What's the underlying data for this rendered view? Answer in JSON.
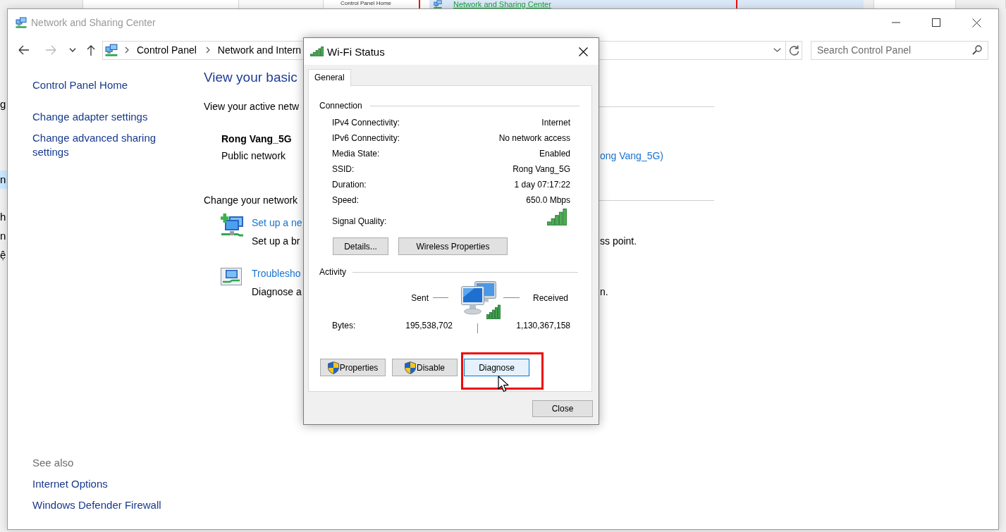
{
  "background_window": {
    "sidebar_link": "Control Panel Home",
    "nav_item": {
      "label": "Network and Sharing Center",
      "selected": true
    },
    "edge_items": [
      {
        "text": "g",
        "selected": false
      },
      {
        "text": "n",
        "selected": true
      },
      {
        "text": "h",
        "selected": false
      },
      {
        "text": "n",
        "selected": false
      },
      {
        "text": "ệ",
        "selected": false
      }
    ]
  },
  "window": {
    "title": "Network and Sharing Center",
    "active": false
  },
  "nav_buttons": [
    {
      "kind": "back",
      "disabled": false
    },
    {
      "kind": "forward",
      "disabled": true
    },
    {
      "kind": "recent",
      "disabled": false
    },
    {
      "kind": "up",
      "disabled": false
    }
  ],
  "address_bar": {
    "breadcrumbs": [
      "Control Panel",
      "Network and Intern"
    ]
  },
  "search": {
    "placeholder": "Search Control Panel"
  },
  "sidebar": {
    "home": "Control Panel Home",
    "items": [
      "Change adapter settings",
      "Change advanced sharing settings"
    ],
    "see_also": {
      "title": "See also",
      "items": [
        "Internet Options",
        "Windows Defender Firewall"
      ]
    }
  },
  "content": {
    "heading": "View your basic",
    "active_networks": {
      "title": "View your active netw",
      "name": "Rong Vang_5G",
      "category": "Public network",
      "connection": "ong Vang_5G)"
    },
    "change_settings": {
      "title": "Change your network",
      "tasks": [
        {
          "kind": "new_connection",
          "link": "Set up a ne",
          "description": "Set up a br",
          "description_end": "ss point."
        },
        {
          "kind": "troubleshoot",
          "link": "Troublesho",
          "description": "Diagnose a",
          "description_end": "n."
        }
      ]
    }
  },
  "dialog": {
    "title": "Wi-Fi Status",
    "tabs": [
      {
        "label": "General",
        "selected": true
      }
    ],
    "connection": {
      "title": "Connection",
      "rows": [
        {
          "label": "IPv4 Connectivity:",
          "value": "Internet"
        },
        {
          "label": "IPv6 Connectivity:",
          "value": "No network access"
        },
        {
          "label": "Media State:",
          "value": "Enabled"
        },
        {
          "label": "SSID:",
          "value": "Rong Vang_5G"
        },
        {
          "label": "Duration:",
          "value": "1 day 07:17:22"
        },
        {
          "label": "Speed:",
          "value": "650.0 Mbps"
        }
      ],
      "signal_label": "Signal Quality:",
      "buttons": [
        "Details...",
        "Wireless Properties"
      ]
    },
    "activity": {
      "title": "Activity",
      "sent_label": "Sent",
      "received_label": "Received",
      "bytes_label": "Bytes:",
      "bytes_sent": "195,538,702",
      "bytes_received": "1,130,367,158"
    },
    "actions": [
      {
        "label": "Properties",
        "shield": true,
        "hovered": false
      },
      {
        "label": "Disable",
        "shield": true,
        "hovered": false
      },
      {
        "label": "Diagnose",
        "shield": false,
        "hovered": true
      }
    ],
    "close_button": "Close"
  }
}
